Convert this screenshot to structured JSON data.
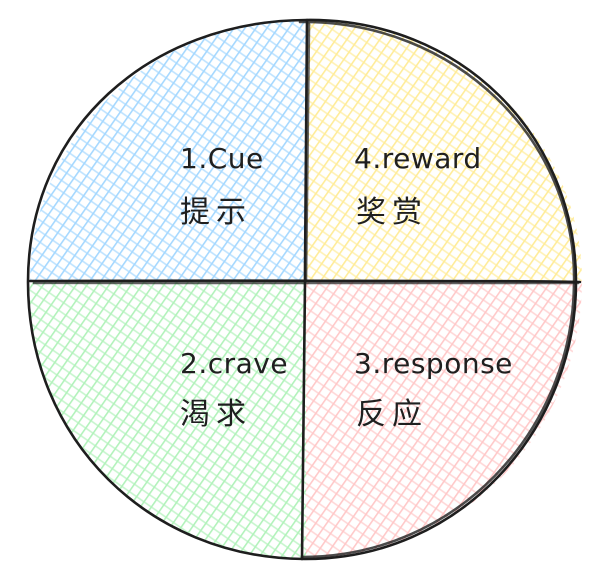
{
  "quadrants": [
    {
      "id": "cue",
      "label": "1.Cue",
      "sub": "提示",
      "color": "#a5d8ff"
    },
    {
      "id": "reward",
      "label": "4.reward",
      "sub": "奖赏",
      "color": "#ffec99"
    },
    {
      "id": "crave",
      "label": "2.crave",
      "sub": "渴求",
      "color": "#b2f2bb"
    },
    {
      "id": "response",
      "label": "3.response",
      "sub": "反应",
      "color": "#ffc9c9"
    }
  ],
  "stroke_color": "#1e1e1e"
}
